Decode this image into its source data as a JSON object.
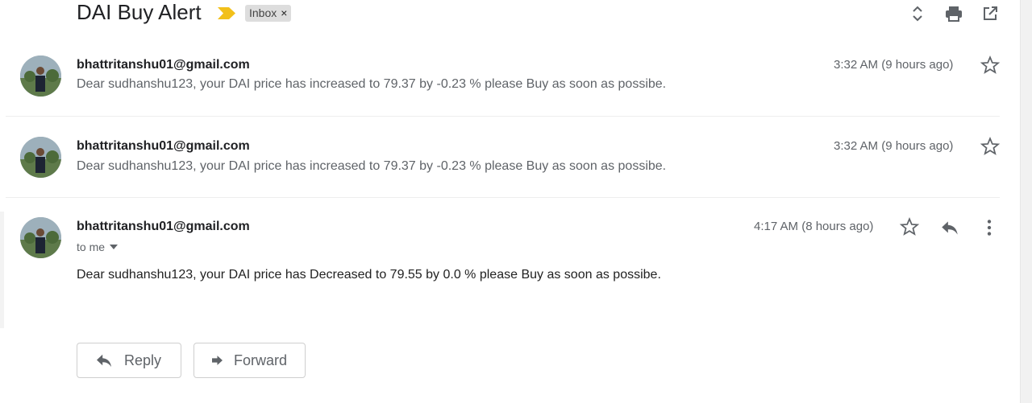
{
  "header": {
    "subject": "DAI Buy Alert",
    "label": "Inbox",
    "label_remove": "×"
  },
  "messages": [
    {
      "sender": "bhattritanshu01@gmail.com",
      "snippet": "Dear sudhanshu123, your DAI price has increased to 79.37 by -0.23 % please Buy as soon as possibe.",
      "time": "3:32 AM (9 hours ago)"
    },
    {
      "sender": "bhattritanshu01@gmail.com",
      "snippet": "Dear sudhanshu123, your DAI price has increased to 79.37 by -0.23 % please Buy as soon as possibe.",
      "time": "3:32 AM (9 hours ago)"
    },
    {
      "sender": "bhattritanshu01@gmail.com",
      "recipient": "to me",
      "time": "4:17 AM (8 hours ago)",
      "body": "Dear sudhanshu123, your DAI price has Decreased to 79.55 by 0.0 % please Buy as soon as possibe."
    }
  ],
  "actions": {
    "reply": "Reply",
    "forward": "Forward"
  },
  "colors": {
    "importance": "#f2c01a",
    "icon": "#5f6368"
  },
  "icons": [
    "importance-marker-icon",
    "expand-collapse-icon",
    "print-icon",
    "open-new-window-icon",
    "star-icon",
    "reply-icon",
    "more-vert-icon",
    "chevron-down-icon",
    "forward-icon"
  ]
}
